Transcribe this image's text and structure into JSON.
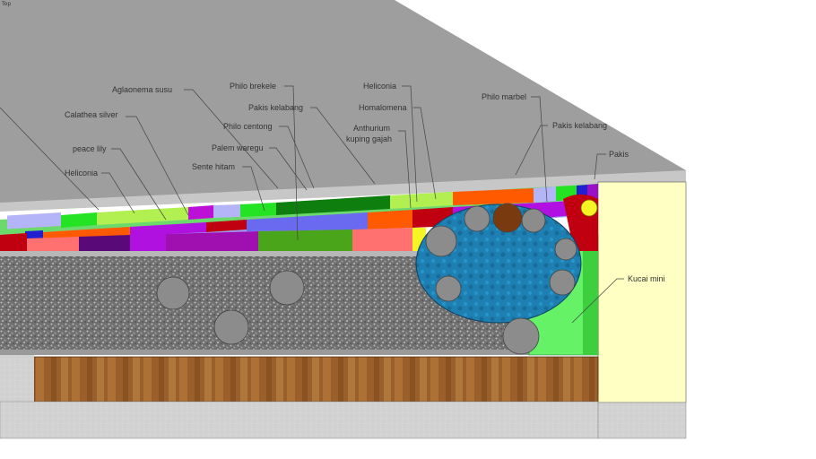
{
  "view_label": "Top",
  "labels": [
    {
      "id": "aglaonema-susu",
      "text": "Aglaonema susu"
    },
    {
      "id": "calathea-silver",
      "text": "Calathea silver"
    },
    {
      "id": "peace-lily",
      "text": "peace lily"
    },
    {
      "id": "heliconia-left",
      "text": "Heliconia"
    },
    {
      "id": "philo-brekele",
      "text": "Philo brekele"
    },
    {
      "id": "pakis-kelabang-1",
      "text": "Pakis kelabang"
    },
    {
      "id": "philo-centong",
      "text": "Philo centong"
    },
    {
      "id": "palem-waregu",
      "text": "Palem waregu"
    },
    {
      "id": "sente-hitam",
      "text": "Sente hitam"
    },
    {
      "id": "heliconia-right",
      "text": "Heliconia"
    },
    {
      "id": "homalomena",
      "text": "Homalomena"
    },
    {
      "id": "anthurium-line1",
      "text": "Anthurium"
    },
    {
      "id": "anthurium-line2",
      "text": "kuping gajah"
    },
    {
      "id": "philo-marbel",
      "text": "Philo marbel"
    },
    {
      "id": "pakis-kelabang-2",
      "text": "Pakis kelabang"
    },
    {
      "id": "pakis",
      "text": "Pakis"
    },
    {
      "id": "kucai-mini",
      "text": "Kucai mini"
    }
  ],
  "colors": {
    "roof": "#9e9e9e",
    "wall": "#ffffc4",
    "pond": "#1f7fb0",
    "kucai": "#66f266",
    "wood": "#a0642c",
    "gravel": "#7a7a7a",
    "concrete": "#cfcfcf"
  }
}
